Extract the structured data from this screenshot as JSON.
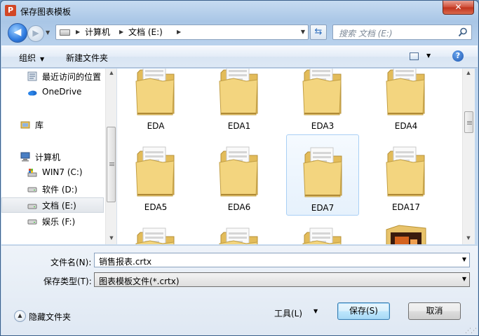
{
  "window": {
    "title": "保存图表模板",
    "app_icon_letter": "P",
    "close_label": "✕"
  },
  "nav": {
    "back_label": "◀",
    "forward_label": "▶",
    "breadcrumb": [
      "计算机",
      "文档 (E:)"
    ],
    "search_placeholder": "搜索 文档 (E:)"
  },
  "toolbar": {
    "organize": "组织",
    "new_folder": "新建文件夹",
    "help": "?"
  },
  "sidebar": {
    "items": [
      {
        "label": "最近访问的位置",
        "icon": "recent-places-icon"
      },
      {
        "label": "OneDrive",
        "icon": "onedrive-icon"
      },
      {
        "label": "库",
        "icon": "library-icon"
      },
      {
        "label": "计算机",
        "icon": "computer-icon"
      },
      {
        "label": "WIN7 (C:)",
        "icon": "system-drive-icon"
      },
      {
        "label": "软件 (D:)",
        "icon": "drive-icon"
      },
      {
        "label": "文档 (E:)",
        "icon": "drive-icon",
        "selected": true
      },
      {
        "label": "娱乐 (F:)",
        "icon": "drive-icon"
      }
    ]
  },
  "files": [
    {
      "name": "EDA",
      "type": "folder"
    },
    {
      "name": "EDA1",
      "type": "folder"
    },
    {
      "name": "EDA3",
      "type": "folder"
    },
    {
      "name": "EDA4",
      "type": "folder"
    },
    {
      "name": "EDA5",
      "type": "folder"
    },
    {
      "name": "EDA6",
      "type": "folder"
    },
    {
      "name": "EDA7",
      "type": "folder",
      "selected": true
    },
    {
      "name": "EDA17",
      "type": "folder"
    },
    {
      "name": "",
      "type": "folder"
    },
    {
      "name": "",
      "type": "folder"
    },
    {
      "name": "",
      "type": "folder"
    },
    {
      "name": "",
      "type": "folder-image"
    }
  ],
  "form": {
    "filename_label": "文件名(N):",
    "filename_value": "销售报表.crtx",
    "filetype_label": "保存类型(T):",
    "filetype_value": "图表模板文件(*.crtx)"
  },
  "footer": {
    "hide_folders": "隐藏文件夹",
    "tools": "工具(L)",
    "save": "保存(S)",
    "cancel": "取消"
  },
  "colors": {
    "accent": "#3c7fb1",
    "folder": "#f1d37a",
    "selected_bg": "#e6f1fc",
    "close": "#c0321d"
  }
}
